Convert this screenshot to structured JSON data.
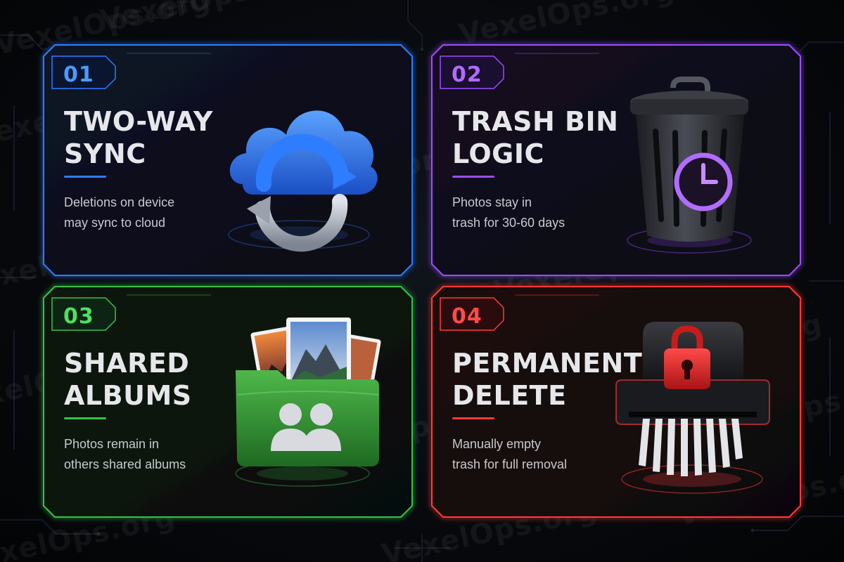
{
  "watermark": "VexelOps.org",
  "cards": [
    {
      "number": "01",
      "title_line1": "TWO-WAY",
      "title_line2": "SYNC",
      "desc_line1": "Deletions on device",
      "desc_line2": "may sync to cloud",
      "color": "#2f7bff",
      "icon": "cloud-sync-icon"
    },
    {
      "number": "02",
      "title_line1": "TRASH BIN",
      "title_line2": "LOGIC",
      "desc_line1": "Photos stay in",
      "desc_line2": "trash for 30-60 days",
      "color": "#9b4dff",
      "icon": "trash-clock-icon"
    },
    {
      "number": "03",
      "title_line1": "SHARED",
      "title_line2": "ALBUMS",
      "desc_line1": "Photos remain in",
      "desc_line2": "others shared albums",
      "color": "#36c24a",
      "icon": "shared-folder-icon"
    },
    {
      "number": "04",
      "title_line1": "PERMANENT",
      "title_line2": "DELETE",
      "desc_line1": "Manually empty",
      "desc_line2": "trash for full removal",
      "color": "#ff3a3a",
      "icon": "shredder-lock-icon"
    }
  ]
}
